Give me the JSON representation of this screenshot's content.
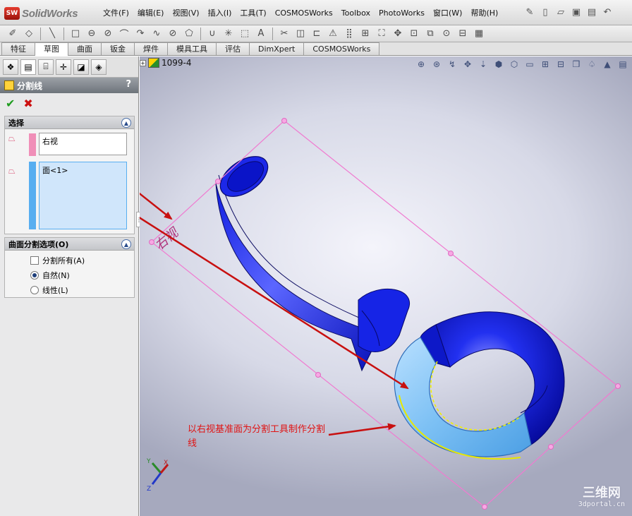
{
  "app": {
    "logo_badge": "SW",
    "logo_text": "SolidWorks"
  },
  "menu": [
    "文件(F)",
    "编辑(E)",
    "视图(V)",
    "插入(I)",
    "工具(T)",
    "COSMOSWorks",
    "Toolbox",
    "PhotoWorks",
    "窗口(W)",
    "帮助(H)"
  ],
  "tabs": [
    "特征",
    "草图",
    "曲面",
    "钣金",
    "焊件",
    "模具工具",
    "评估",
    "DimXpert",
    "COSMOSWorks"
  ],
  "active_tab": "草图",
  "property_manager": {
    "title": "分割线",
    "help": "?",
    "ok_symbol": "✔",
    "cancel_symbol": "✖",
    "selection_group": {
      "title": "选择",
      "plane_value": "右视",
      "faces_value": "面<1>",
      "plane_color": "#f08fb8",
      "faces_color": "#58aef0"
    },
    "options_group": {
      "title": "曲面分割选项(O)",
      "split_all_label": "分割所有(A)",
      "natural_label": "自然(N)",
      "linear_label": "线性(L)",
      "split_all_checked": false,
      "selected_mode": "natural"
    }
  },
  "viewport": {
    "document_name": "1099-4",
    "plane_label": "右视",
    "annotation": "以右视基准面为分割工具制作分割线",
    "watermark_main": "三维网",
    "watermark_sub": "3dportal.cn",
    "triad_labels": [
      "Y",
      "X",
      "Z"
    ],
    "colors": {
      "part_blue": "#0a14d8",
      "selected_face": "#7cc0f4",
      "plane_outline": "#f07ad0",
      "arrow_red": "#c81010"
    }
  }
}
